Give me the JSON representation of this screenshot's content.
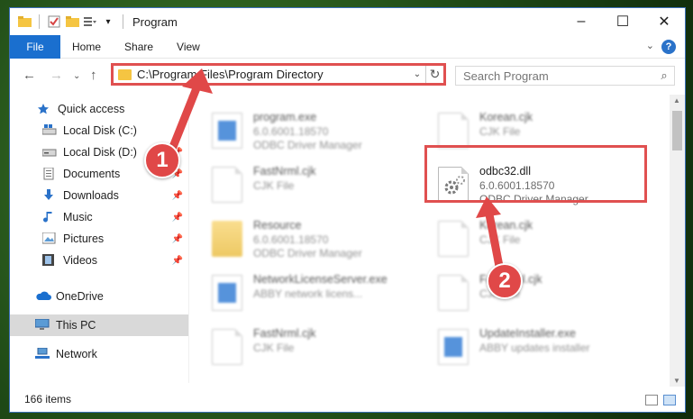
{
  "window": {
    "title": "Program",
    "controls": [
      "–",
      "☐",
      "✕"
    ]
  },
  "ribbon": {
    "tabs": [
      "File",
      "Home",
      "Share",
      "View"
    ],
    "help": "?",
    "chevron": "⌄"
  },
  "nav": {
    "back": "←",
    "forward": "→",
    "recent": "⌄",
    "up": "↑"
  },
  "address": {
    "path": "C:\\Program Files\\Program Directory",
    "dropdown": "⌄",
    "refresh": "↻"
  },
  "search": {
    "placeholder": "Search Program",
    "icon": "⌕"
  },
  "sidebar": {
    "items": [
      {
        "label": "Quick access",
        "icon": "star-icon"
      },
      {
        "label": "Local Disk (C:)",
        "icon": "drive-icon"
      },
      {
        "label": "Local Disk (D:)",
        "icon": "drive-icon"
      },
      {
        "label": "Documents",
        "icon": "documents-icon"
      },
      {
        "label": "Downloads",
        "icon": "download-icon"
      },
      {
        "label": "Music",
        "icon": "music-icon"
      },
      {
        "label": "Pictures",
        "icon": "pictures-icon"
      },
      {
        "label": "Videos",
        "icon": "videos-icon"
      },
      {
        "label": "OneDrive",
        "icon": "cloud-icon"
      },
      {
        "label": "This PC",
        "icon": "computer-icon"
      },
      {
        "label": "Network",
        "icon": "network-icon"
      }
    ]
  },
  "files": [
    {
      "name": "program.exe",
      "line1": "6.0.6001.18570",
      "line2": "ODBC Driver Manager"
    },
    {
      "name": "Korean.cjk",
      "line1": "CJK File",
      "line2": ""
    },
    {
      "name": "FastNrml.cjk",
      "line1": "CJK File",
      "line2": ""
    },
    {
      "name": "odbc32.dll",
      "line1": "6.0.6001.18570",
      "line2": "ODBC Driver Manager"
    },
    {
      "name": "Resource",
      "line1": "6.0.6001.18570",
      "line2": "ODBC Driver Manager"
    },
    {
      "name": "Korean.cjk",
      "line1": "CJK File",
      "line2": ""
    },
    {
      "name": "NetworkLicenseServer.exe",
      "line1": "ABBY network licens...",
      "line2": ""
    },
    {
      "name": "FastNrml.cjk",
      "line1": "CJK File",
      "line2": ""
    },
    {
      "name": "FastNrml.cjk",
      "line1": "CJK File",
      "line2": ""
    },
    {
      "name": "UpdateInstaller.exe",
      "line1": "ABBY updates installer",
      "line2": ""
    }
  ],
  "status": {
    "count": "166 items"
  },
  "callouts": [
    "1",
    "2"
  ],
  "colors": {
    "accent": "#1a6fcf",
    "highlight": "#e05050"
  }
}
